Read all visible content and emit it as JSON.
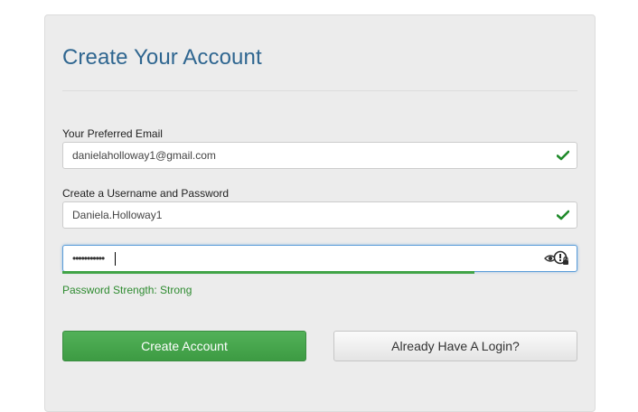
{
  "form": {
    "title": "Create Your Account",
    "email_label": "Your Preferred Email",
    "email_value": "danielaholloway1@gmail.com",
    "credentials_label": "Create a Username and Password",
    "username_value": "Daniela.Holloway1",
    "password_value": "•••••••••••",
    "password_strength": "Password Strength: Strong",
    "password_strength_level": 0.8,
    "create_button": "Create Account",
    "login_button": "Already Have A Login?"
  },
  "colors": {
    "title": "#2f6690",
    "success": "#2e8b30",
    "primary_button": "#47a84d",
    "focus_border": "#5b9dd9"
  },
  "icons": {
    "valid": "check-icon",
    "reveal": "eye-icon",
    "password_manager": "key-icon"
  }
}
